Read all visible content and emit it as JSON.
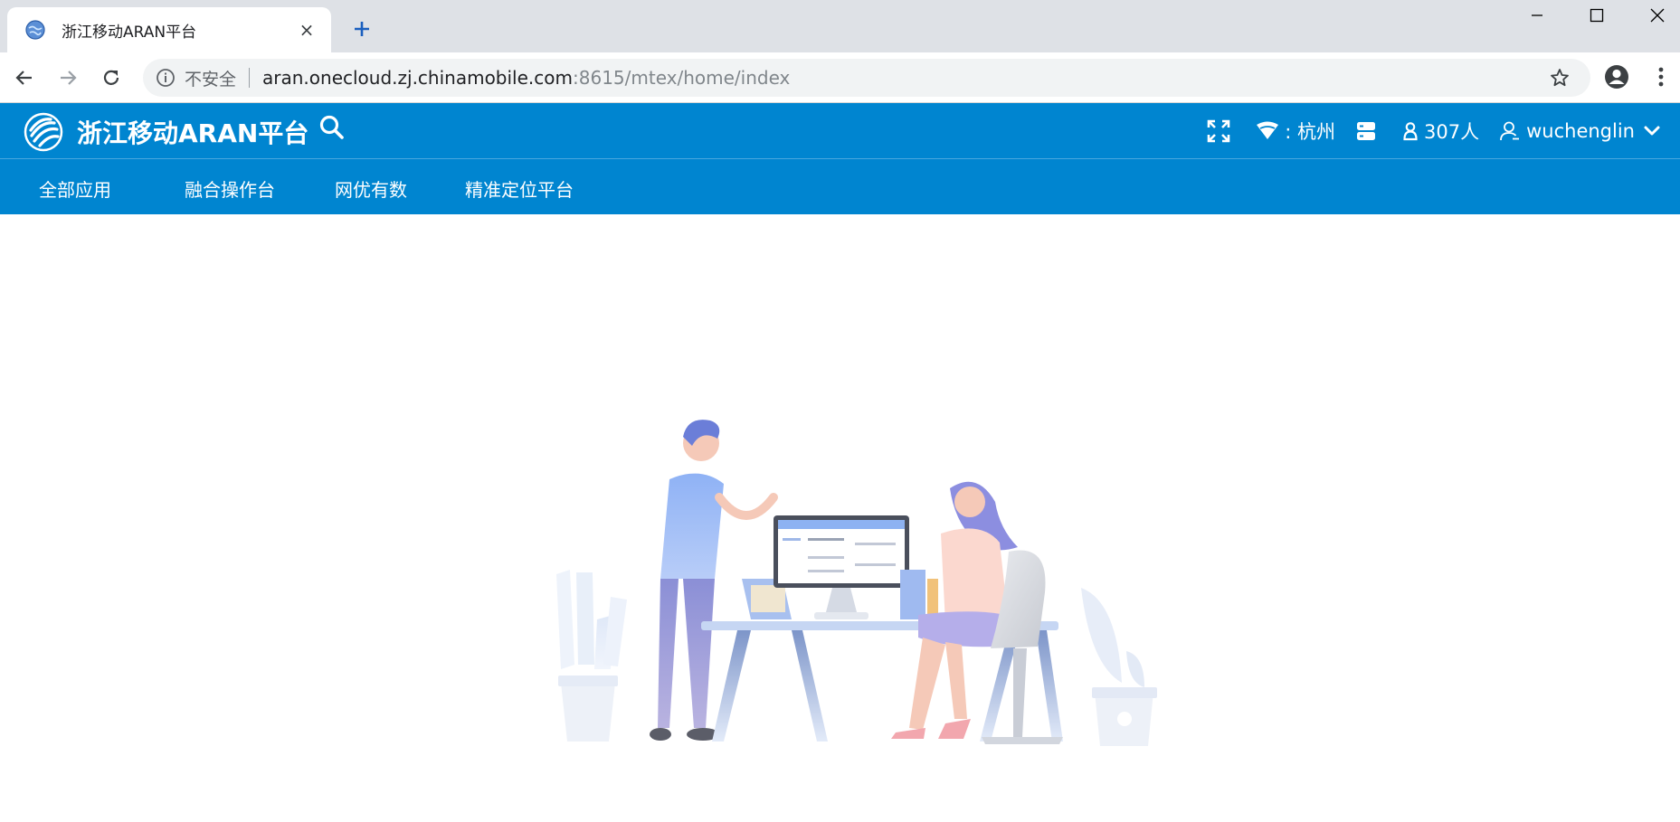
{
  "browser": {
    "tab_title": "浙江移动ARAN平台",
    "tab_close": "×",
    "security_label": "不安全",
    "url_host": "aran.onecloud.zj.chinamobile.com",
    "url_path": ":8615/mtex/home/index"
  },
  "header": {
    "brand": "浙江移动ARAN平台",
    "region": ": 杭州",
    "online_count": "307人",
    "username": "wuchenglin"
  },
  "nav": {
    "items": [
      {
        "label": "全部应用"
      },
      {
        "label": "融合操作台"
      },
      {
        "label": "网优有数"
      },
      {
        "label": "精准定位平台"
      }
    ]
  },
  "colors": {
    "brand_blue": "#0085d0",
    "tab_strip": "#dee1e6"
  },
  "icons": [
    "globe-icon",
    "new-tab-icon",
    "back-icon",
    "forward-icon",
    "reload-icon",
    "info-icon",
    "star-icon",
    "profile-icon",
    "menu-icon",
    "fullscreen-icon",
    "wifi-icon",
    "server-icon",
    "user-count-icon",
    "user-icon",
    "chevron-down-icon",
    "search-icon"
  ]
}
